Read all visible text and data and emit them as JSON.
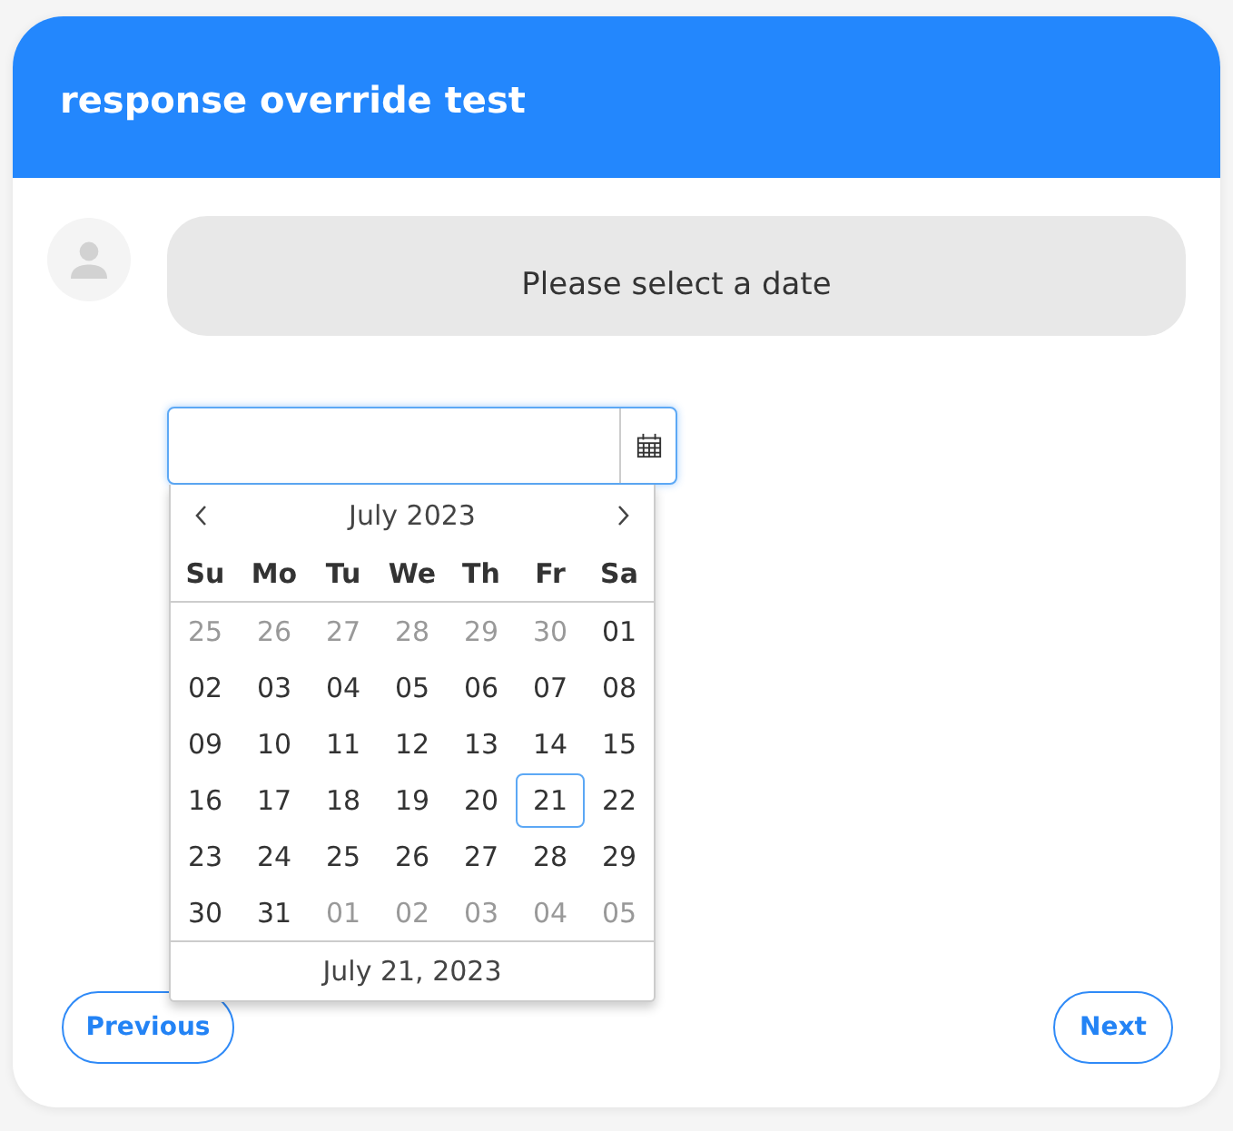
{
  "header": {
    "title": "response override test"
  },
  "message": {
    "text": "Please select a date"
  },
  "date_field": {
    "focused": true
  },
  "datepicker": {
    "open": true,
    "month_label": "July 2023",
    "weekdays": [
      "Su",
      "Mo",
      "Tu",
      "We",
      "Th",
      "Fr",
      "Sa"
    ],
    "weeks": [
      [
        {
          "day": "25",
          "outside": true,
          "selected": false
        },
        {
          "day": "26",
          "outside": true,
          "selected": false
        },
        {
          "day": "27",
          "outside": true,
          "selected": false
        },
        {
          "day": "28",
          "outside": true,
          "selected": false
        },
        {
          "day": "29",
          "outside": true,
          "selected": false
        },
        {
          "day": "30",
          "outside": true,
          "selected": false
        },
        {
          "day": "01",
          "outside": false,
          "selected": false
        }
      ],
      [
        {
          "day": "02",
          "outside": false,
          "selected": false
        },
        {
          "day": "03",
          "outside": false,
          "selected": false
        },
        {
          "day": "04",
          "outside": false,
          "selected": false
        },
        {
          "day": "05",
          "outside": false,
          "selected": false
        },
        {
          "day": "06",
          "outside": false,
          "selected": false
        },
        {
          "day": "07",
          "outside": false,
          "selected": false
        },
        {
          "day": "08",
          "outside": false,
          "selected": false
        }
      ],
      [
        {
          "day": "09",
          "outside": false,
          "selected": false
        },
        {
          "day": "10",
          "outside": false,
          "selected": false
        },
        {
          "day": "11",
          "outside": false,
          "selected": false
        },
        {
          "day": "12",
          "outside": false,
          "selected": false
        },
        {
          "day": "13",
          "outside": false,
          "selected": false
        },
        {
          "day": "14",
          "outside": false,
          "selected": false
        },
        {
          "day": "15",
          "outside": false,
          "selected": false
        }
      ],
      [
        {
          "day": "16",
          "outside": false,
          "selected": false
        },
        {
          "day": "17",
          "outside": false,
          "selected": false
        },
        {
          "day": "18",
          "outside": false,
          "selected": false
        },
        {
          "day": "19",
          "outside": false,
          "selected": false
        },
        {
          "day": "20",
          "outside": false,
          "selected": false
        },
        {
          "day": "21",
          "outside": false,
          "selected": true
        },
        {
          "day": "22",
          "outside": false,
          "selected": false
        }
      ],
      [
        {
          "day": "23",
          "outside": false,
          "selected": false
        },
        {
          "day": "24",
          "outside": false,
          "selected": false
        },
        {
          "day": "25",
          "outside": false,
          "selected": false
        },
        {
          "day": "26",
          "outside": false,
          "selected": false
        },
        {
          "day": "27",
          "outside": false,
          "selected": false
        },
        {
          "day": "28",
          "outside": false,
          "selected": false
        },
        {
          "day": "29",
          "outside": false,
          "selected": false
        }
      ],
      [
        {
          "day": "30",
          "outside": false,
          "selected": false
        },
        {
          "day": "31",
          "outside": false,
          "selected": false
        },
        {
          "day": "01",
          "outside": true,
          "selected": false
        },
        {
          "day": "02",
          "outside": true,
          "selected": false
        },
        {
          "day": "03",
          "outside": true,
          "selected": false
        },
        {
          "day": "04",
          "outside": true,
          "selected": false
        },
        {
          "day": "05",
          "outside": true,
          "selected": false
        }
      ]
    ],
    "footer": "July 21, 2023"
  },
  "buttons": [
    {
      "kind": "previous",
      "label": "Previous"
    },
    {
      "kind": "next",
      "label": "Next"
    }
  ]
}
